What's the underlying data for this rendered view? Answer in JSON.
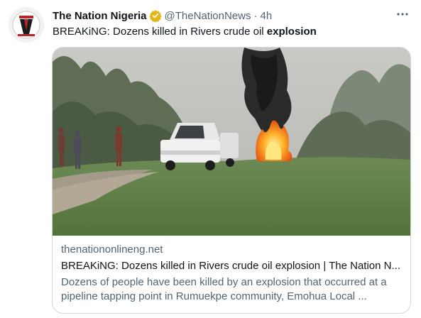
{
  "tweet": {
    "author_name": "The Nation Nigeria",
    "handle": "@TheNationNews",
    "separator": "·",
    "time": "4h",
    "text_prefix": "BREAKiNG: Dozens killed in Rivers crude oil ",
    "text_bold": "explosion",
    "more_icon": "more-horizontal-icon",
    "verified_icon": "verified-badge-icon",
    "verified_color": "#e2b719"
  },
  "card": {
    "image_alt": "Burning crude oil site with smoke and a white pickup truck",
    "domain": "thenationonlineng.net",
    "title": "BREAKiNG: Dozens killed in Rivers crude oil explosion | The Nation N...",
    "description": "Dozens of people have been killed by an explosion that occurred at a pipeline tapping point in Rumuekpe community, Emohua Local ..."
  },
  "colors": {
    "text_primary": "#0f1419",
    "text_secondary": "#536471",
    "border": "#cfd9de"
  }
}
